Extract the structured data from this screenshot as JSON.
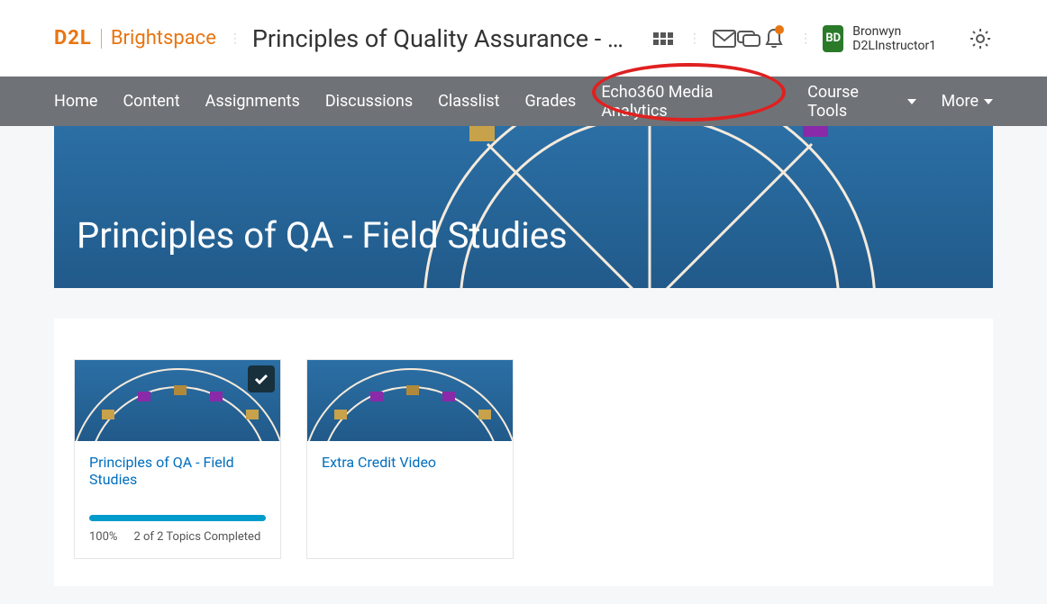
{
  "brand": {
    "d2l": "D2L",
    "brightspace": "Brightspace"
  },
  "header": {
    "course_title": "Principles of Quality Assurance - …",
    "user_initials": "BD",
    "user_name": "Bronwyn D2LInstructor1"
  },
  "nav": {
    "items": [
      {
        "label": "Home",
        "dropdown": false
      },
      {
        "label": "Content",
        "dropdown": false
      },
      {
        "label": "Assignments",
        "dropdown": false
      },
      {
        "label": "Discussions",
        "dropdown": false
      },
      {
        "label": "Classlist",
        "dropdown": false
      },
      {
        "label": "Grades",
        "dropdown": false
      },
      {
        "label": "Echo360 Media Analytics",
        "dropdown": false,
        "highlighted": true
      },
      {
        "label": "Course Tools",
        "dropdown": true
      },
      {
        "label": "More",
        "dropdown": true
      }
    ]
  },
  "banner": {
    "title": "Principles of QA - Field Studies"
  },
  "cards": [
    {
      "title": "Principles of QA - Field Studies",
      "completed": true,
      "progress_pct": 100,
      "progress_label": "100%",
      "status_text": "2 of 2 Topics Completed"
    },
    {
      "title": "Extra Credit Video",
      "completed": false
    }
  ],
  "colors": {
    "accent_orange": "#e87511",
    "link_blue": "#006fbf",
    "nav_bg": "#6f7377",
    "highlight_red": "#e02020"
  }
}
